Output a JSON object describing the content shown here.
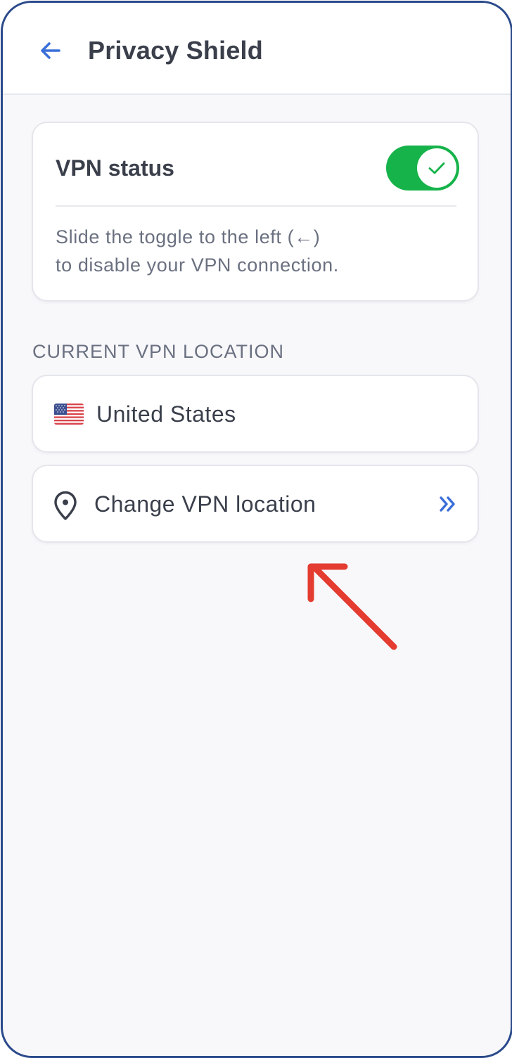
{
  "header": {
    "title": "Privacy Shield",
    "back_icon": "arrow-left-icon",
    "accent_color": "#3a6fd8"
  },
  "vpn_card": {
    "label": "VPN status",
    "toggle_on": true,
    "toggle_color": "#16b34a",
    "hint_line1": "Slide the toggle to the left (←)",
    "hint_line2": "to disable your VPN connection."
  },
  "location_section": {
    "label": "CURRENT VPN LOCATION",
    "country": "United States",
    "flag_icon": "us-flag-icon"
  },
  "change_location": {
    "label": "Change VPN location",
    "icon": "map-pin-icon",
    "chevron_icon": "double-chevron-right-icon"
  },
  "annotation": {
    "icon": "red-arrow-icon",
    "color": "#e43c30"
  }
}
